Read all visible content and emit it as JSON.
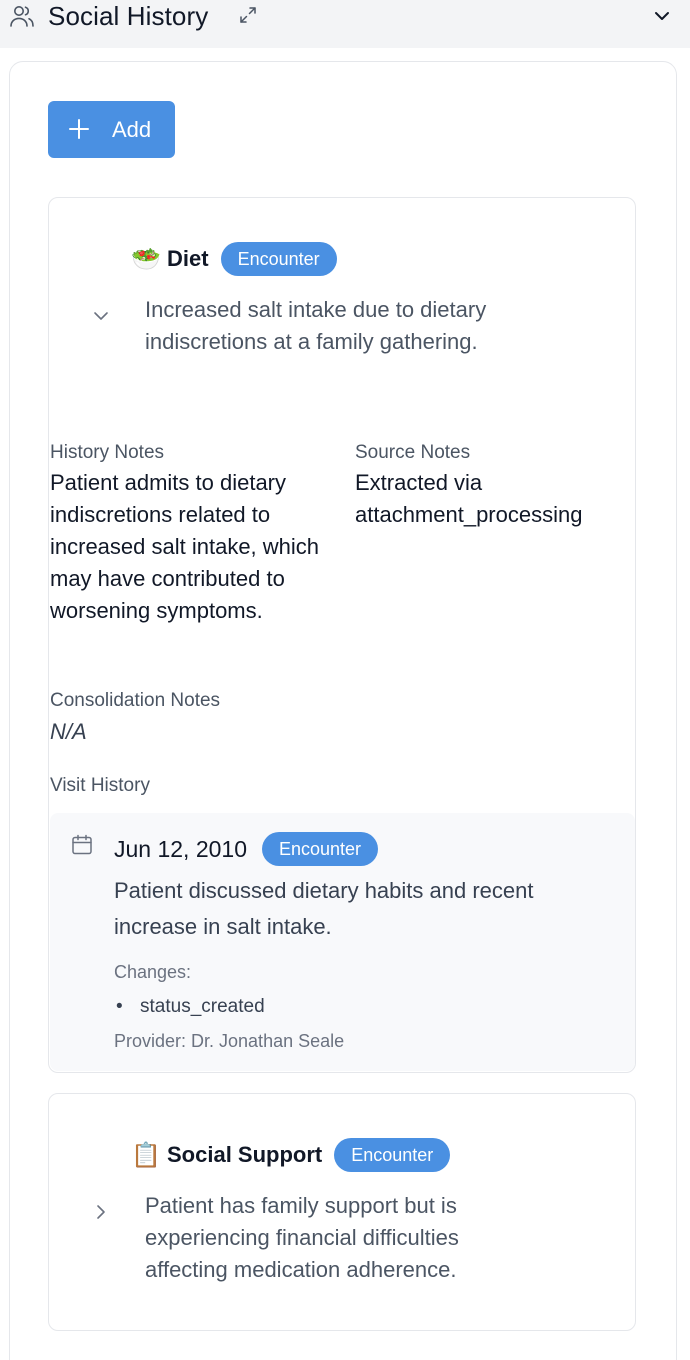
{
  "header": {
    "title": "Social History",
    "icons": {
      "section": "people-icon",
      "expand": "expand-icon",
      "collapse": "chevron-down-icon"
    }
  },
  "add_button": {
    "label": "Add",
    "icon": "plus-icon"
  },
  "colors": {
    "accent": "#4a90e2",
    "header_bg": "#f3f4f6",
    "visit_bg": "#f8f9fb"
  },
  "items": [
    {
      "emoji": "🥗",
      "name": "Diet",
      "badge": "Encounter",
      "expanded": true,
      "summary": "Increased salt intake due to dietary indiscretions at a family gathering.",
      "history_notes_label": "History Notes",
      "history_notes": "Patient admits to dietary indiscretions related to increased salt intake, which may have contributed to worsening symptoms.",
      "source_notes_label": "Source Notes",
      "source_notes": "Extracted via attachment_processing",
      "consolidation_notes_label": "Consolidation Notes",
      "consolidation_notes": "N/A",
      "visit_history_label": "Visit History",
      "visits": [
        {
          "date": "Jun 12, 2010",
          "badge": "Encounter",
          "description": "Patient discussed dietary habits and recent increase in salt intake.",
          "changes_label": "Changes:",
          "changes": [
            "status_created"
          ],
          "provider": "Provider: Dr. Jonathan Seale"
        }
      ]
    },
    {
      "emoji": "📋",
      "name": "Social Support",
      "badge": "Encounter",
      "expanded": false,
      "summary": "Patient has family support but is experiencing financial difficulties affecting medication adherence."
    }
  ]
}
